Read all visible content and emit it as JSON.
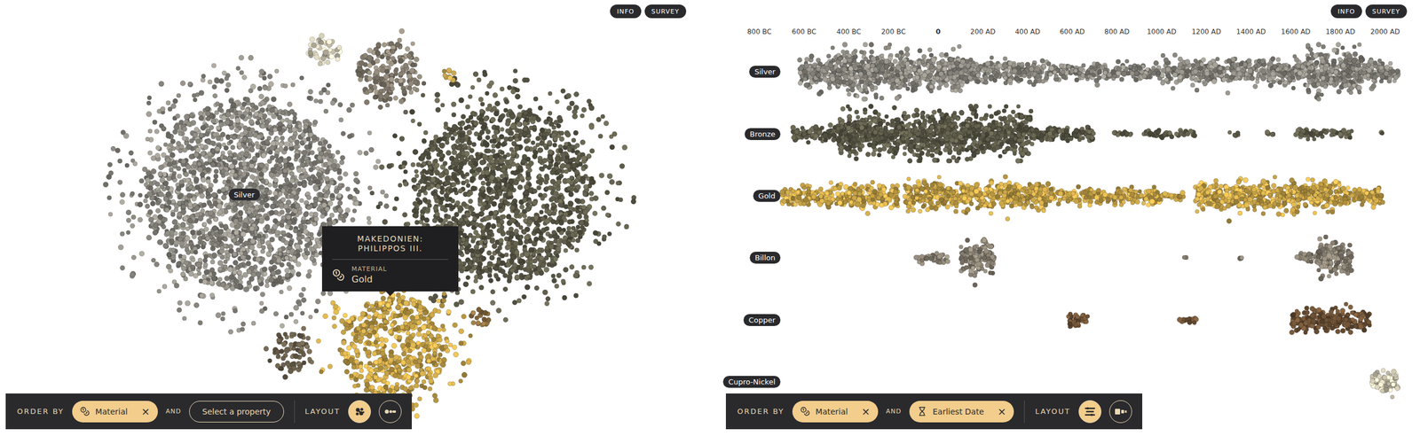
{
  "left": {
    "header": {
      "buttons": [
        "INFO",
        "SURVEY"
      ]
    },
    "clusters": [
      {
        "color": "#8d8a82",
        "label": "Silver"
      },
      {
        "color": "#5e5c4a"
      },
      {
        "color": "#c9a548"
      },
      {
        "color": "#8a8274"
      },
      {
        "color": "#d3cdb6"
      },
      {
        "color": "#6a5f4c"
      },
      {
        "color": "#8a6c3e"
      },
      {
        "color": "#cdaa52"
      }
    ],
    "tooltip": {
      "title": "MAKEDONIEN: PHILIPPOS III.",
      "property": "MATERIAL",
      "value": "Gold"
    },
    "toolbar": {
      "label": "ORDER BY",
      "properties": [
        {
          "label": "Material",
          "kind": "material",
          "remove": "×"
        }
      ],
      "joiner": "AND",
      "placeholder": "Select a property",
      "layout_label": "LAYOUT",
      "layouts": [
        {
          "kind": "cluster",
          "selected": true
        },
        {
          "kind": "line",
          "selected": false
        }
      ]
    }
  },
  "right": {
    "header": {
      "buttons": [
        "INFO",
        "SURVEY"
      ]
    },
    "ticks": [
      {
        "label": "800 BC",
        "strong": false
      },
      {
        "label": "600 BC",
        "strong": false
      },
      {
        "label": "400 BC",
        "strong": false
      },
      {
        "label": "200 BC",
        "strong": false
      },
      {
        "label": "0",
        "strong": true
      },
      {
        "label": "200 AD",
        "strong": false
      },
      {
        "label": "400 AD",
        "strong": false
      },
      {
        "label": "600 AD",
        "strong": false
      },
      {
        "label": "800 AD",
        "strong": false
      },
      {
        "label": "1000 AD",
        "strong": false
      },
      {
        "label": "1200 AD",
        "strong": false
      },
      {
        "label": "1400 AD",
        "strong": false
      },
      {
        "label": "1600 AD",
        "strong": false
      },
      {
        "label": "1800 AD",
        "strong": false
      },
      {
        "label": "2000 AD",
        "strong": false
      }
    ],
    "rows": [
      {
        "label": "Silver",
        "color": "#8d8a82",
        "spans": [
          [
            -620,
            -450,
            0.7
          ],
          [
            -450,
            -150,
            1
          ],
          [
            -150,
            150,
            0.85
          ],
          [
            150,
            500,
            0.5
          ],
          [
            500,
            1000,
            0.35
          ],
          [
            1000,
            1650,
            0.55
          ],
          [
            1650,
            1900,
            1
          ],
          [
            1900,
            2060,
            0.5
          ]
        ]
      },
      {
        "label": "Bronze",
        "color": "#5e5c4a",
        "spans": [
          [
            -650,
            -450,
            0.3
          ],
          [
            -450,
            -100,
            0.9
          ],
          [
            -100,
            420,
            1
          ],
          [
            420,
            700,
            0.35
          ],
          [
            780,
            880,
            0.1
          ],
          [
            920,
            1150,
            0.15
          ],
          [
            1300,
            1350,
            0.08
          ],
          [
            1450,
            1500,
            0.08
          ],
          [
            1600,
            1850,
            0.2
          ],
          [
            1980,
            2000,
            0.08
          ]
        ]
      },
      {
        "label": "Gold",
        "color": "#c9a548",
        "spans": [
          [
            -790,
            -760,
            0.1
          ],
          [
            -700,
            -400,
            0.45
          ],
          [
            -400,
            -180,
            0.55
          ],
          [
            -150,
            500,
            0.6
          ],
          [
            500,
            1000,
            0.35
          ],
          [
            1000,
            1100,
            0.2
          ],
          [
            1150,
            1800,
            0.65
          ],
          [
            1800,
            1990,
            0.4
          ]
        ]
      },
      {
        "label": "Billon",
        "color": "#8a8274",
        "spans": [
          [
            -790,
            -770,
            0.1
          ],
          [
            -100,
            50,
            0.2
          ],
          [
            100,
            250,
            0.8
          ],
          [
            1100,
            1120,
            0.05
          ],
          [
            1350,
            1400,
            0.05
          ],
          [
            1600,
            1700,
            0.2
          ],
          [
            1700,
            1850,
            0.8
          ]
        ]
      },
      {
        "label": "Copper",
        "color": "#6e5236",
        "spans": [
          [
            580,
            680,
            0.3
          ],
          [
            1080,
            1160,
            0.15
          ],
          [
            1580,
            1930,
            0.5
          ]
        ]
      },
      {
        "label": "Cupro-Nickel",
        "color": "#d3cdb6",
        "spans": [
          [
            1940,
            2060,
            0.6
          ]
        ]
      }
    ],
    "toolbar": {
      "label": "ORDER BY",
      "properties": [
        {
          "label": "Material",
          "kind": "material",
          "remove": "×"
        },
        {
          "label": "Earliest Date",
          "kind": "date",
          "remove": "×"
        }
      ],
      "joiner": "AND",
      "layout_label": "LAYOUT",
      "layouts": [
        {
          "kind": "rows",
          "selected": true
        },
        {
          "kind": "blocks",
          "selected": false
        }
      ]
    }
  }
}
